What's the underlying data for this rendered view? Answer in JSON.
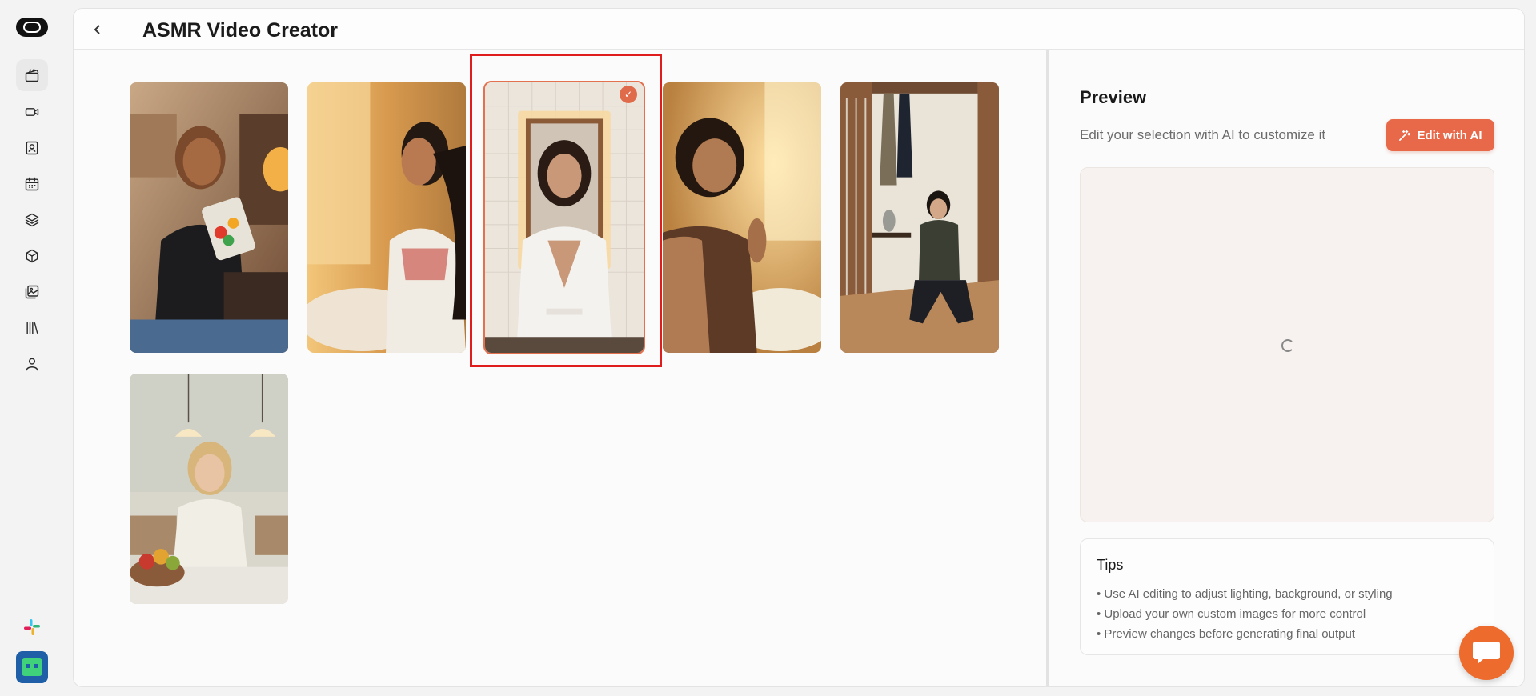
{
  "app": {
    "title": "ASMR Video Creator"
  },
  "rail": {
    "items": [
      {
        "icon": "clapperboard-icon"
      },
      {
        "icon": "video-camera-icon"
      },
      {
        "icon": "contact-card-icon"
      },
      {
        "icon": "calendar-icon"
      },
      {
        "icon": "layers-icon"
      },
      {
        "icon": "cube-icon"
      },
      {
        "icon": "gallery-icon"
      },
      {
        "icon": "library-icon"
      },
      {
        "icon": "user-icon"
      }
    ],
    "active_index": 0
  },
  "gallery": {
    "images": [
      {
        "name": "image-girl-gummy-bag",
        "selected": false
      },
      {
        "name": "image-woman-bathroom-sink",
        "selected": false
      },
      {
        "name": "image-woman-robe-mirror",
        "selected": true
      },
      {
        "name": "image-woman-glowing-mirror",
        "selected": false
      },
      {
        "name": "image-man-crouching-hallway",
        "selected": false
      },
      {
        "name": "image-woman-dining-table",
        "selected": false
      }
    ],
    "check_glyph": "✓"
  },
  "preview": {
    "title": "Preview",
    "subtitle": "Edit your selection with AI to customize it",
    "edit_button": "Edit with AI"
  },
  "tips": {
    "title": "Tips",
    "items": [
      "Use AI editing to adjust lighting, background, or styling",
      "Upload your own custom images for more control",
      "Preview changes before generating final output"
    ]
  },
  "colors": {
    "accent": "#e8694a",
    "selection_outline": "#e01d1d",
    "chat_button": "#ec6b2d"
  }
}
